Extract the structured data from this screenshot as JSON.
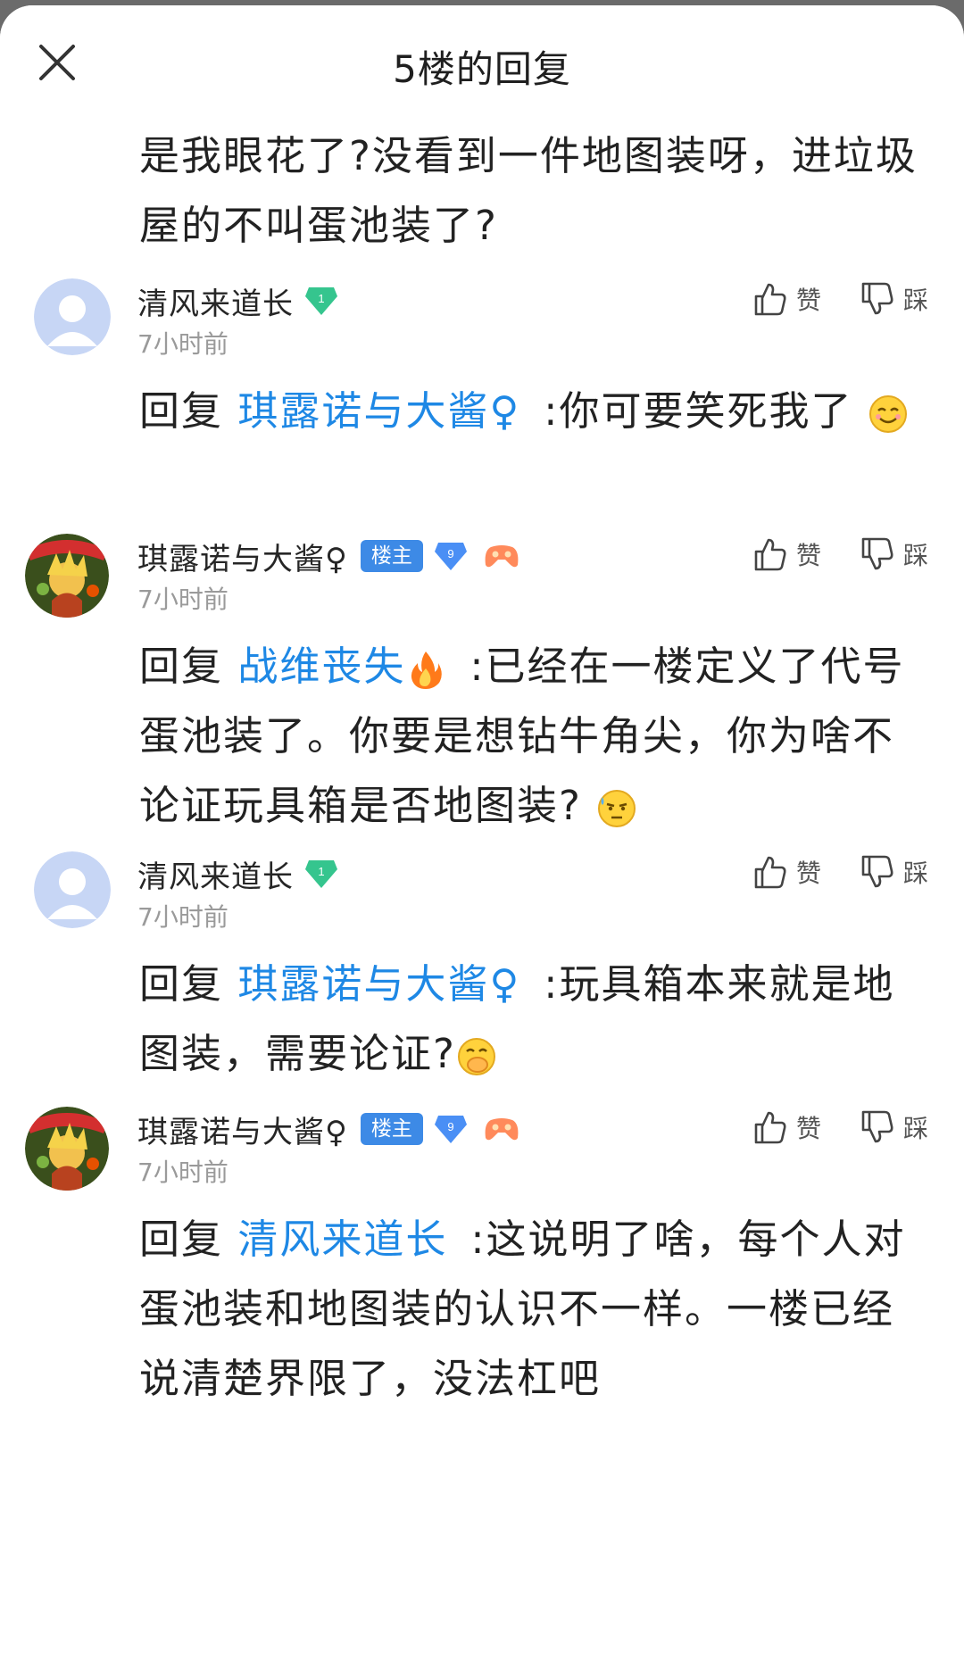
{
  "header": {
    "title": "5楼的回复"
  },
  "first_text": "是我眼花了?没看到一件地图装呀，进垃圾屋的不叫蛋池装了?",
  "actions": {
    "like_label": "赞",
    "dislike_label": "踩"
  },
  "replies": [
    {
      "user": "清风来道长",
      "level": "1",
      "time": "7小时前",
      "reply_prefix": "回复",
      "mention": "琪露诺与大酱♀",
      "text": ":你可要笑死我了"
    },
    {
      "user": "琪露诺与大酱♀",
      "owner_tag": "楼主",
      "level": "9",
      "time": "7小时前",
      "reply_prefix": "回复",
      "mention": "战维丧失",
      "text": ":已经在一楼定义了代号蛋池装了。你要是想钻牛角尖，你为啥不论证玩具箱是否地图装?"
    },
    {
      "user": "清风来道长",
      "level": "1",
      "time": "7小时前",
      "reply_prefix": "回复",
      "mention": "琪露诺与大酱♀",
      "text": ":玩具箱本来就是地图装，需要论证?"
    },
    {
      "user": "琪露诺与大酱♀",
      "owner_tag": "楼主",
      "level": "9",
      "time": "7小时前",
      "reply_prefix": "回复",
      "mention": "清风来道长",
      "text": ":这说明了啥，每个人对蛋池装和地图装的认识不一样。一楼已经说清楚界限了，没法杠吧"
    }
  ]
}
